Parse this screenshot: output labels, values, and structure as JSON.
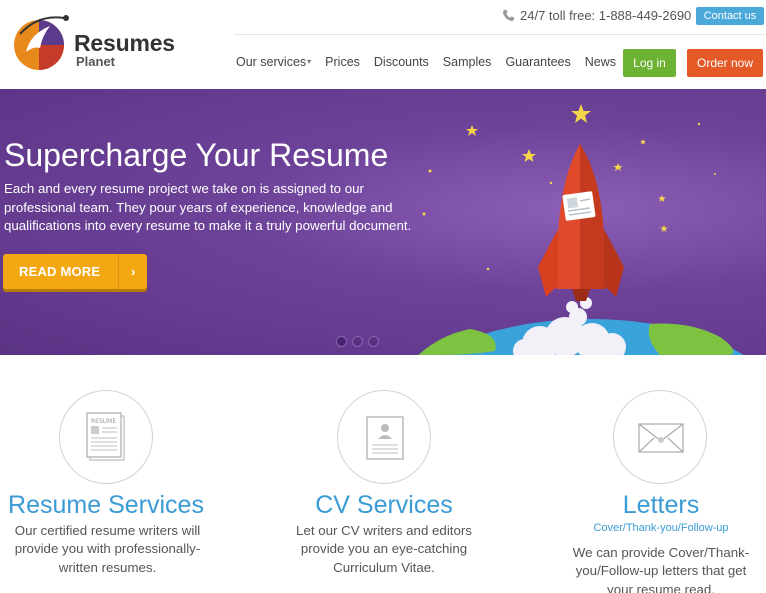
{
  "header": {
    "logo_line1": "Resumes",
    "logo_line2": "Planet",
    "phone": "24/7 toll free: 1-888-449-2690",
    "contact_label": "Contact us",
    "nav": [
      {
        "label": "Our services",
        "has_dropdown": true
      },
      {
        "label": "Prices"
      },
      {
        "label": "Discounts"
      },
      {
        "label": "Samples"
      },
      {
        "label": "Guarantees"
      },
      {
        "label": "News"
      }
    ],
    "login_label": "Log in",
    "order_label": "Order now"
  },
  "hero": {
    "title": "Supercharge Your Resume",
    "text": "Each and every resume project we take on is assigned to our professional team. They pour years of experience, knowledge and qualifications into every resume to make it a truly powerful document.",
    "button_label": "READ MORE",
    "button_arrow": "›",
    "slides": 3,
    "active_slide": 1
  },
  "services": [
    {
      "title": "Resume Services",
      "subtitle": "",
      "desc": "Our certified resume writers will provide you with professionally-written resumes.",
      "icon": "resume-icon"
    },
    {
      "title": "CV Services",
      "subtitle": "",
      "desc": "Let our CV writers and editors provide you an eye-catching Curriculum Vitae.",
      "icon": "cv-icon"
    },
    {
      "title": "Letters",
      "subtitle": "Cover/Thank-you/Follow-up",
      "desc": "We can provide Cover/Thank-you/Follow-up letters that get your resume read.",
      "icon": "envelope-icon"
    }
  ],
  "colors": {
    "brand_blue": "#3a9bd5",
    "login_green": "#6cb233",
    "order_orange": "#e45926",
    "hero_purple": "#6d4399",
    "cta_yellow": "#f3a712"
  }
}
